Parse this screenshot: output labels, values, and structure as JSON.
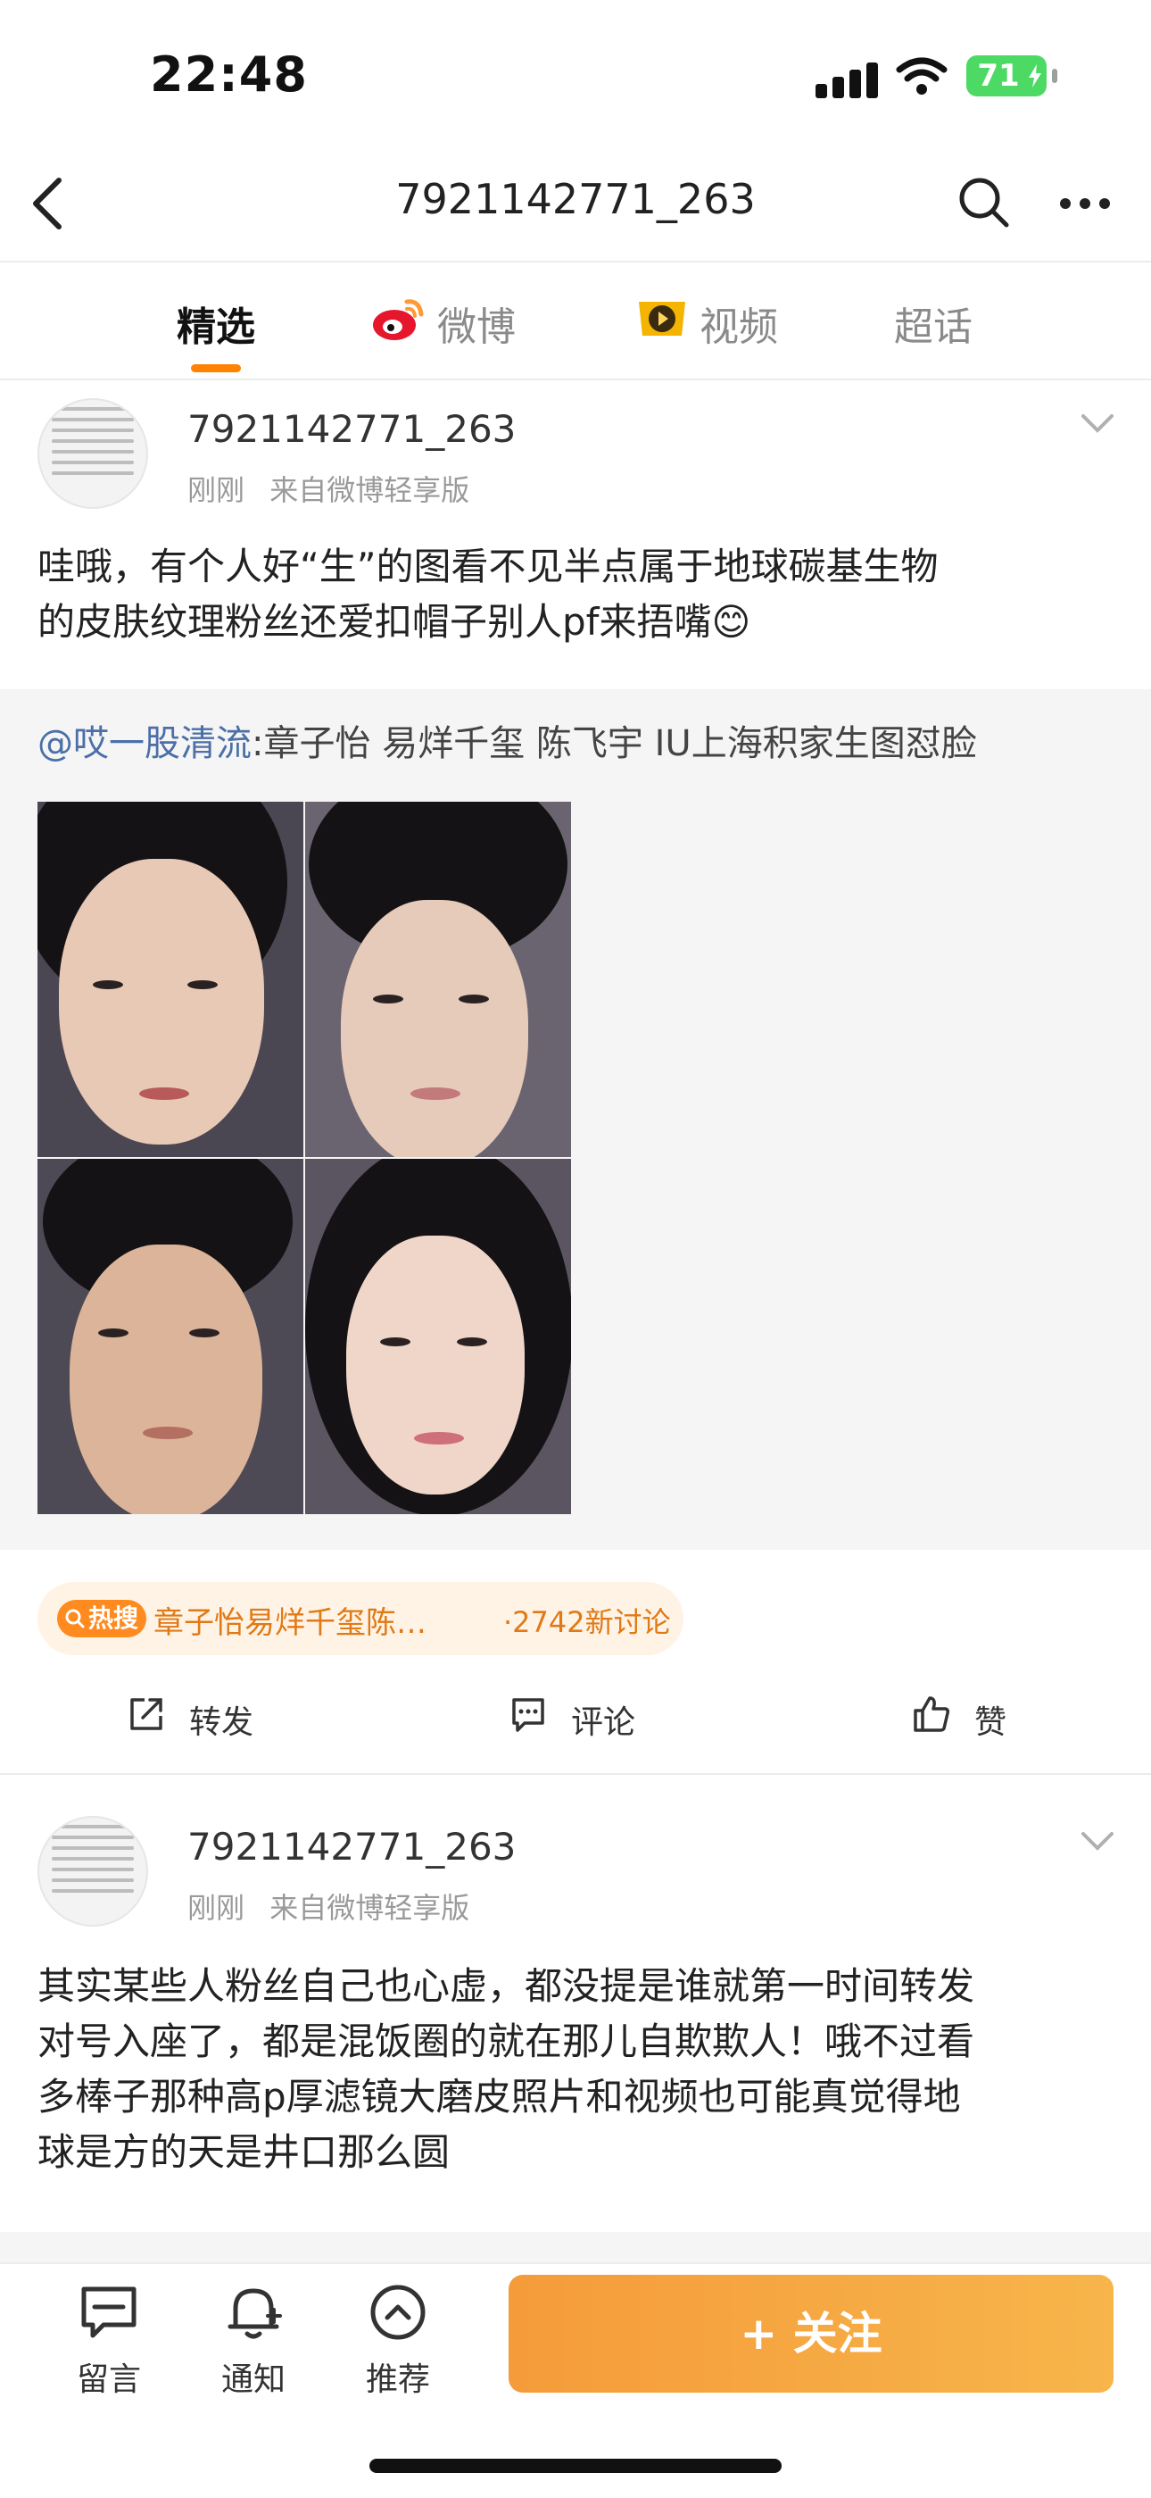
{
  "status_bar": {
    "time": "22:48",
    "battery": "71"
  },
  "nav": {
    "title": "7921142771_263"
  },
  "tabs": [
    {
      "label": "精选",
      "active": true
    },
    {
      "label": "微博",
      "active": false
    },
    {
      "label": "视频",
      "active": false
    },
    {
      "label": "超话",
      "active": false
    }
  ],
  "posts": [
    {
      "username": "7921142771_263",
      "time": "刚刚",
      "source": "来自微博轻享版",
      "text_line1": "哇哦，有个人好“生”的图看不见半点属于地球碳基生物",
      "text_line2": "的皮肤纹理粉丝还爱扣帽子别人pf来捂嘴😊",
      "repost": {
        "mention": "@哎一股清流",
        "text": ":章子怡 易烊千玺 陈飞宇 IU上海积家生图怼脸",
        "photo_count": 4
      },
      "hot_topic": {
        "badge": "热搜",
        "title": "章子怡易烊千玺陈…",
        "count": "·2742新讨论"
      },
      "actions": {
        "repost": "转发",
        "comment": "评论",
        "like": "赞"
      }
    },
    {
      "username": "7921142771_263",
      "time": "刚刚",
      "source": "来自微博轻享版",
      "lines": [
        "其实某些人粉丝自己也心虚，都没提是谁就第一时间转发",
        "对号入座了，都是混饭圈的就在那儿自欺欺人！哦不过看",
        "多棒子那种高p厚滤镜大磨皮照片和视频也可能真觉得地",
        "球是方的天是井口那么圆"
      ]
    }
  ],
  "bottom_bar": {
    "message": "留言",
    "notify": "通知",
    "recommend": "推荐",
    "follow": "+ 关注"
  },
  "colors": {
    "accent": "#ff8200",
    "link": "#4b6fa8",
    "follow_start": "#f59b3a",
    "follow_end": "#f7b54a"
  },
  "icons": [
    "back-icon",
    "search-icon",
    "more-icon",
    "weibo-logo-icon",
    "video-icon",
    "chevron-down-icon",
    "share-icon",
    "comment-icon",
    "like-icon",
    "message-icon",
    "bell-icon",
    "recommend-icon"
  ]
}
